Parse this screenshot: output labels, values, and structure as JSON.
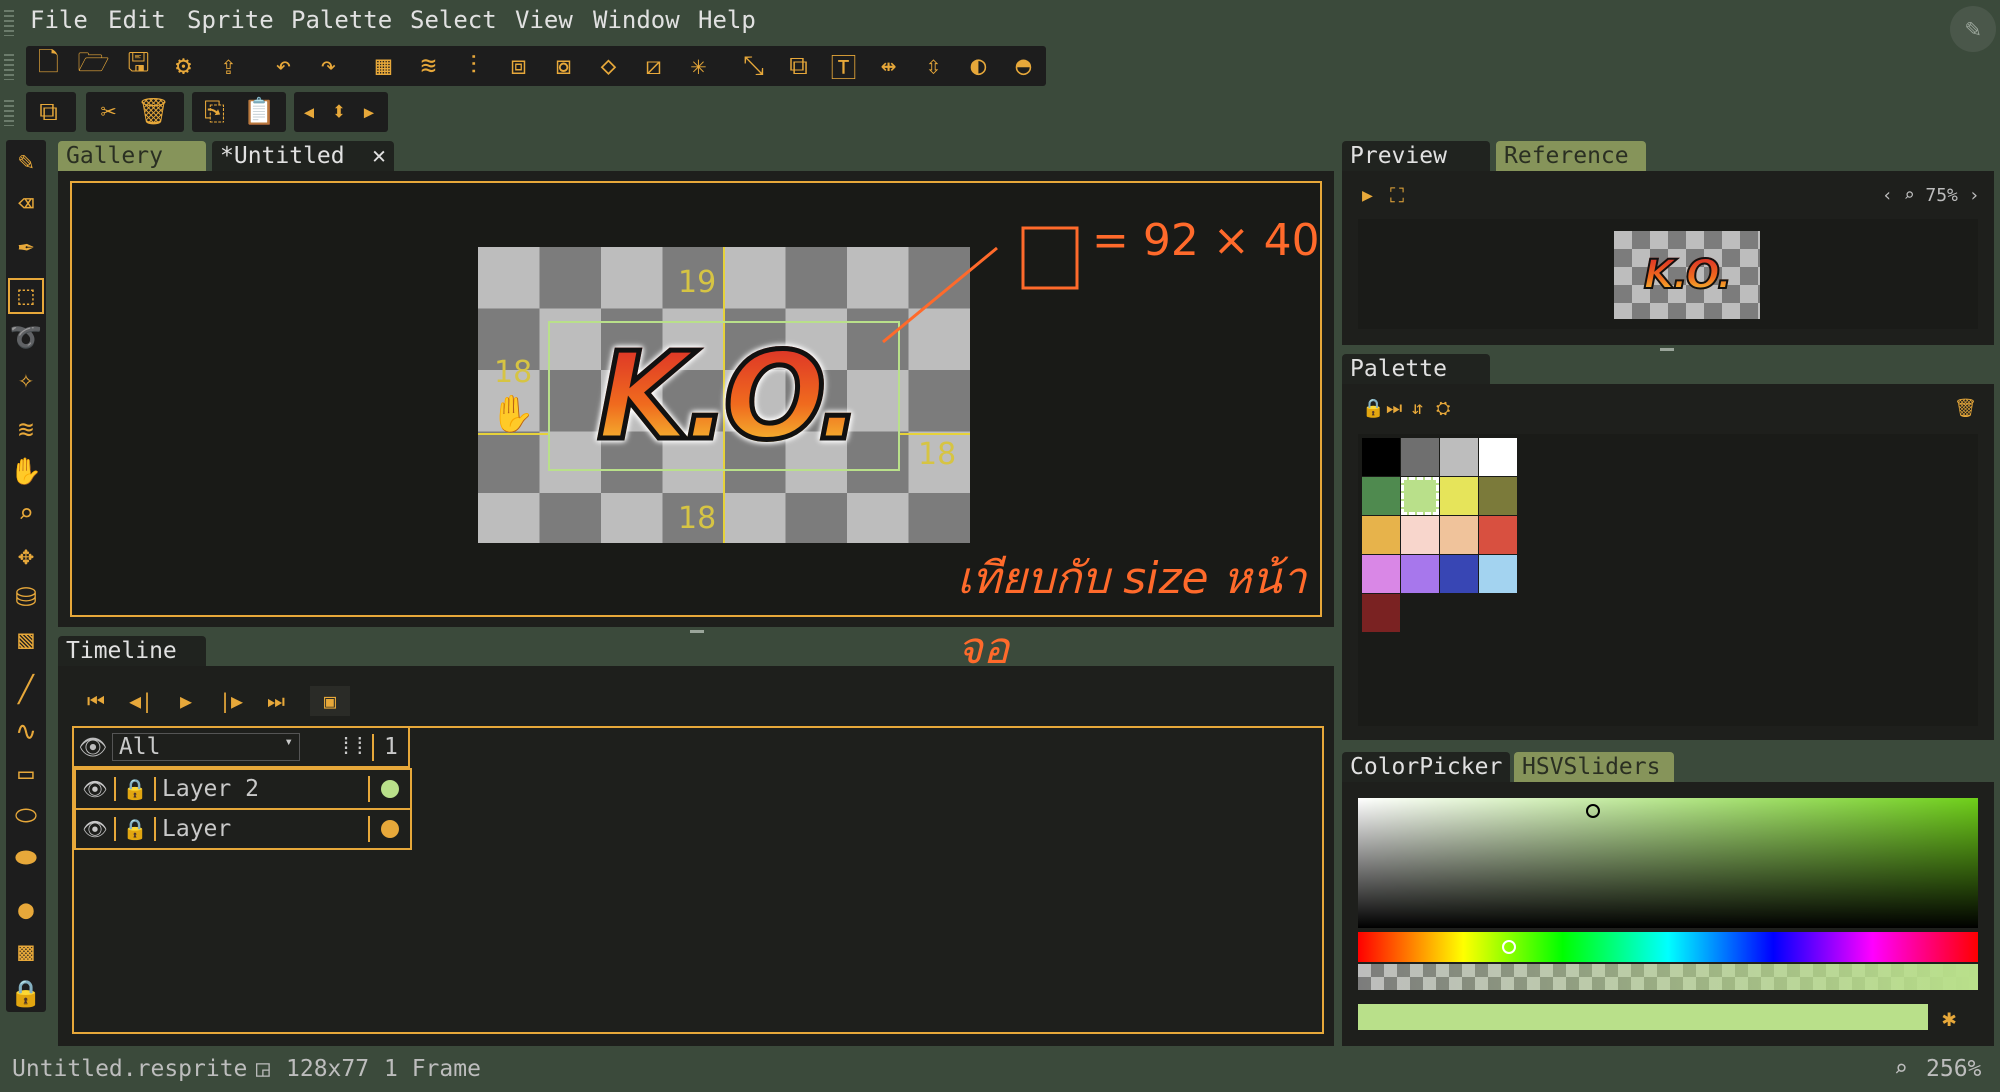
{
  "menu": [
    "File",
    "Edit",
    "Sprite",
    "Palette",
    "Select",
    "View",
    "Window",
    "Help"
  ],
  "tabs": {
    "gallery": "Gallery",
    "untitled": "*Untitled",
    "close": "✕"
  },
  "canvas": {
    "annotation_size": "= 92 × 40",
    "annotation_thai": "เทียบกับ size หน้าจอ",
    "guide_top": "19",
    "guide_left": "18",
    "guide_right": "18",
    "guide_bottom": "18",
    "sprite_text": "K.O."
  },
  "timeline": {
    "title": "Timeline",
    "filter": "All",
    "frame_col": "1",
    "layers": [
      {
        "name": "Layer 2",
        "cel_color": "#b9e08a"
      },
      {
        "name": "Layer",
        "cel_color": "#e7a83a"
      }
    ]
  },
  "preview": {
    "tab1": "Preview",
    "tab2": "Reference",
    "zoom": "75%"
  },
  "palette": {
    "title": "Palette",
    "colors": [
      "#000000",
      "#6f6f6f",
      "#bdbdbd",
      "#ffffff",
      "#4f8a4f",
      "#b9e08a",
      "#e6e45a",
      "#7b7a3a",
      "#e7b34b",
      "#f8d6cc",
      "#f0c39b",
      "#d85040",
      "#d987e6",
      "#a777ec",
      "#3846b4",
      "#a3d3f0",
      "#7a2222"
    ]
  },
  "colorpicker": {
    "tab1": "ColorPicker",
    "tab2": "HSVSliders",
    "current": "#b9e08a"
  },
  "status": {
    "file": "Untitled.resprite",
    "size": "128x77",
    "frames": "1 Frame",
    "zoom": "256%"
  },
  "colors": {
    "accent": "#e7a83a",
    "bg": "#3b4a3b",
    "panel": "#1e1f1c"
  }
}
